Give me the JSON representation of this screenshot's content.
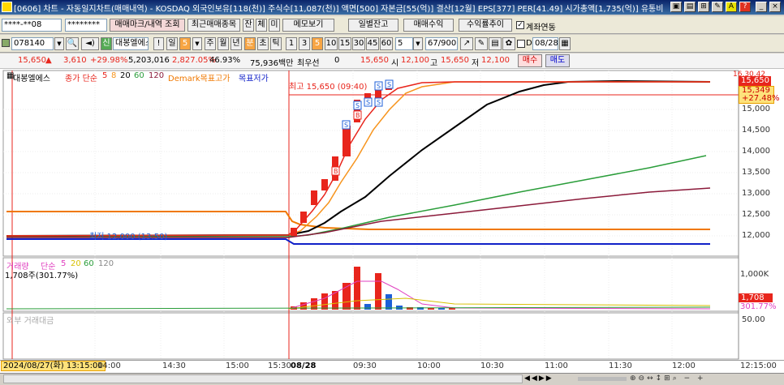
{
  "window": {
    "title": "[0606] 차트 - 자동일지차트(매매내역) - KOSDAQ 외국인보유[118(천)] 주식수[11,087(천)] 액면[500] 자본금[55(억)] 결산[12월] EPS[377] PER[41.49] 시가총액[1,735(억)] 유통비율[..."
  },
  "toolbar1": {
    "account": "****-**08",
    "password": "********",
    "trade_mark_btn": "매매마크/내역 조회",
    "recent_btn": "최근매매종목",
    "jan": "잔",
    "che": "체",
    "mi": "미",
    "memo_btn": "메모보기",
    "daily_btn": "일별잔고",
    "profit_btn": "매매수익",
    "return_btn": "수익률추이",
    "link_label": "계좌연동"
  },
  "toolbar2": {
    "code": "078140",
    "stock_name": "대봉엘에스",
    "excl": "!",
    "day": "일",
    "day_num": "5",
    "week": "주",
    "month": "월",
    "year": "년",
    "min": "분",
    "cho": "초",
    "tick": "틱",
    "periods": [
      "1",
      "3",
      "5",
      "10",
      "15",
      "30",
      "45",
      "60"
    ],
    "count": "5",
    "range": "67/900",
    "d_label": "D",
    "date": "08/28"
  },
  "quote": {
    "price": "15,650",
    "change": "3,610",
    "change_pct": "+29.98%",
    "volume": "5,203,016",
    "vol_ratio": "2,827.05%",
    "turnover": "46.93%",
    "amount": "75,936백만",
    "priority": "최우선",
    "bid": "0",
    "hi_lo": "15,650",
    "si_label": "시",
    "si": "12,100",
    "go_label": "고",
    "go": "15,650",
    "jeo_label": "저",
    "jeo": "12,100",
    "buy_btn": "매수",
    "sell_btn": "매도"
  },
  "price_pane": {
    "name": "대봉엘에스",
    "ma_label": "종가 단순",
    "ma_periods": [
      "5",
      "8",
      "20",
      "60",
      "120"
    ],
    "demark": "Demark목표고가",
    "demark_low": "목표저가",
    "high_label": "최고 15,650 (09:40)",
    "low_label": "최저 12,000 (13:50)",
    "axis": [
      "15,000",
      "14,500",
      "14,000",
      "13,500",
      "13,000",
      "12,500",
      "12,000"
    ],
    "last_box": "15,650",
    "sub_box": "15,349",
    "sub_pct": "+27.48%",
    "top_clip": "16,30.42"
  },
  "volume_pane": {
    "name": "거래량",
    "ma_label": "단순",
    "ma_periods": [
      "5",
      "20",
      "60",
      "120"
    ],
    "value": "1,708주(301.77%)",
    "axis_top": "1,000K",
    "last_box": "1,708",
    "last_pct": "301.77%"
  },
  "third_pane": {
    "name": "외부 거래대금",
    "axis": "50.00"
  },
  "time_axis": {
    "cursor": "2024/08/27(화) 13:15:00",
    "labels": [
      "14:00",
      "14:30",
      "15:00",
      "15:30",
      "08/28",
      "09:30",
      "10:00",
      "10:30",
      "11:00",
      "11:30",
      "12:00"
    ],
    "right": "12:15:00"
  },
  "colors": {
    "up": "#e8251c",
    "down": "#1c5fd8",
    "ma5": "#e8251c",
    "ma8": "#f7941d",
    "ma20": "#000000",
    "ma60": "#2a9d3a",
    "ma120": "#8b1a3a"
  }
}
